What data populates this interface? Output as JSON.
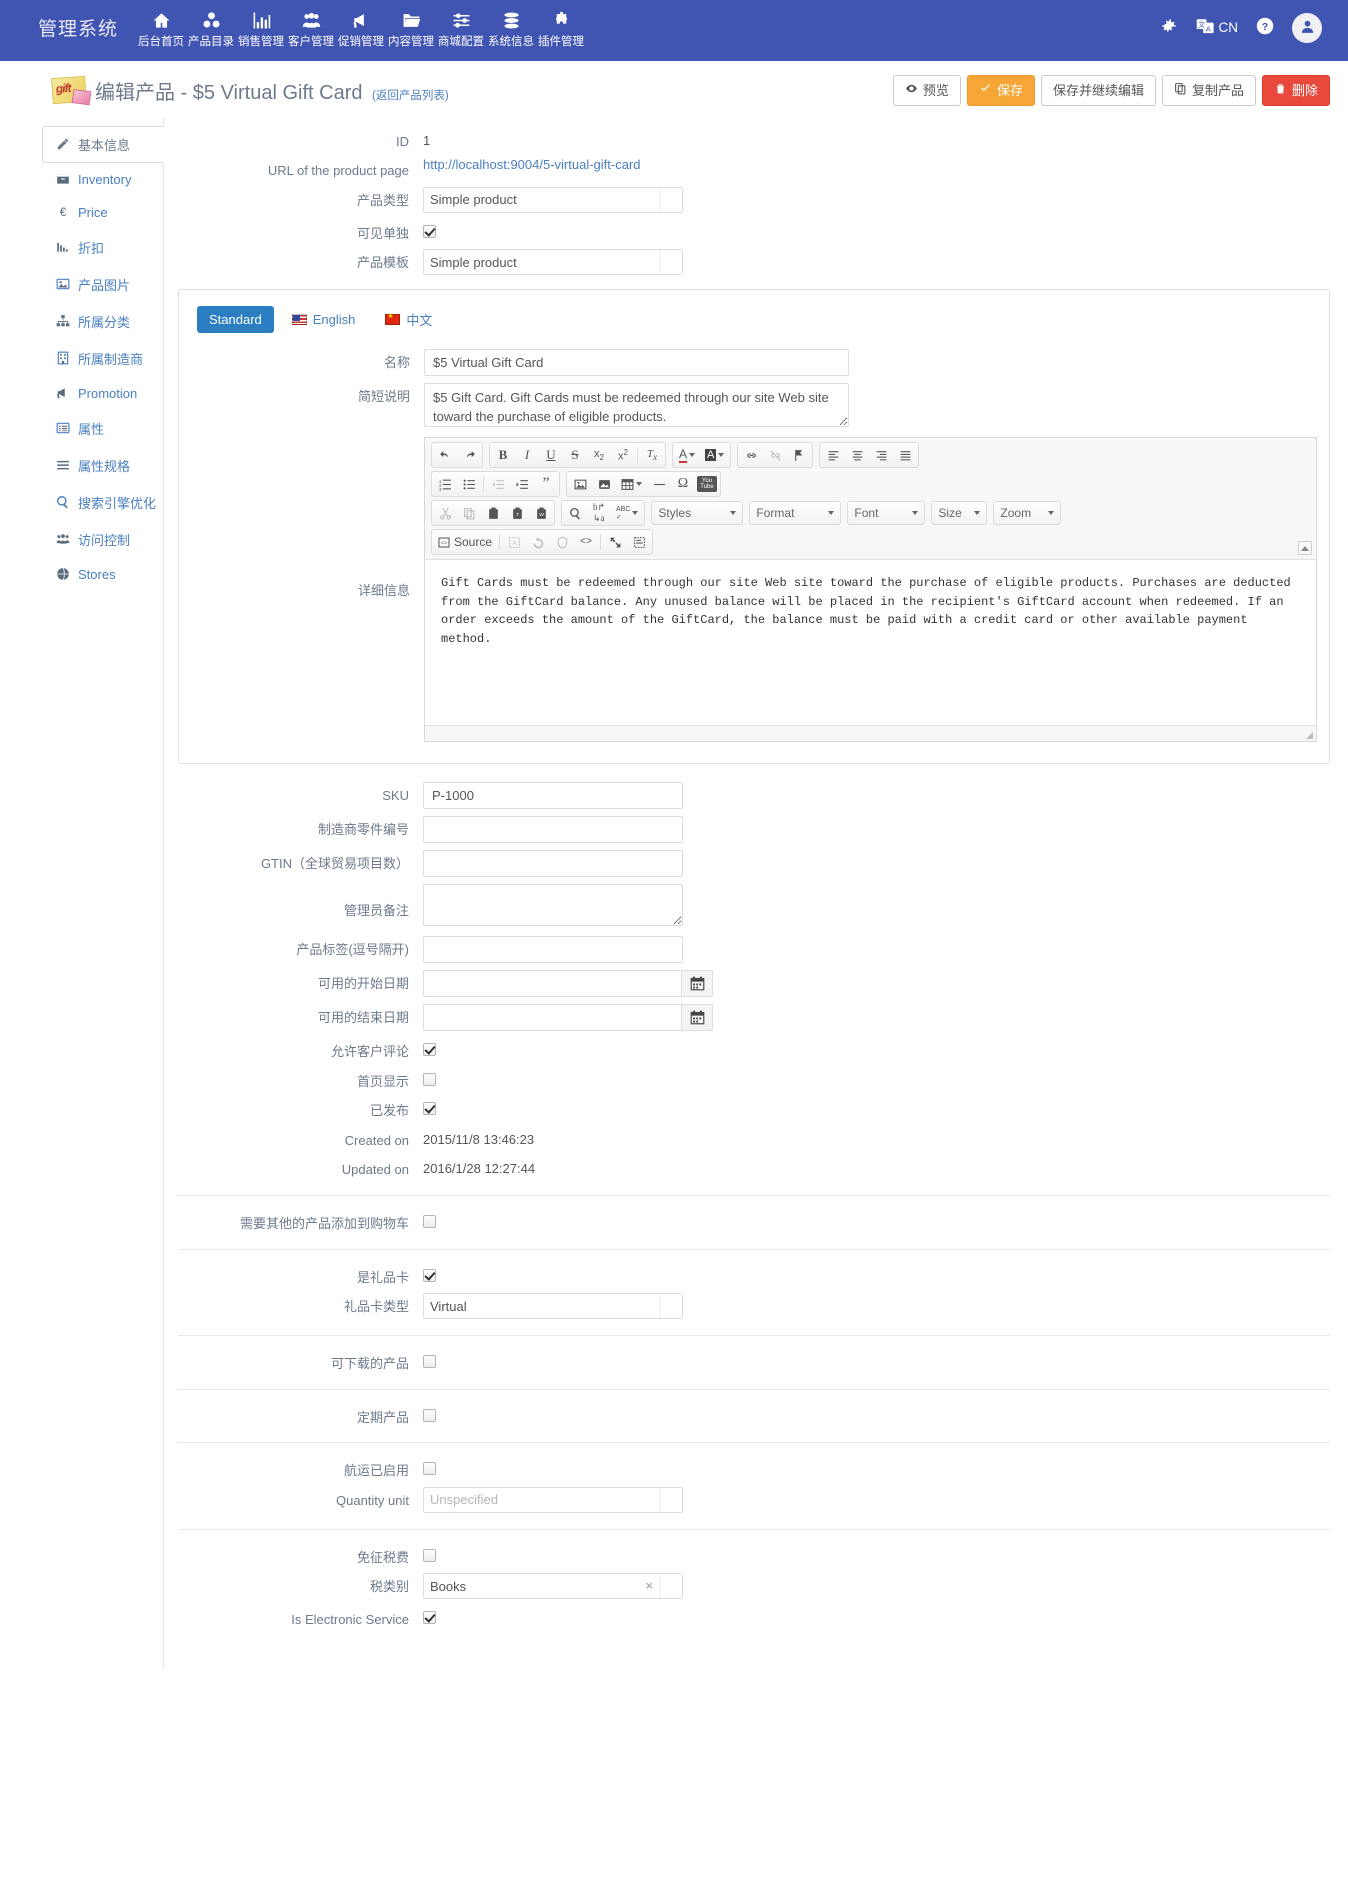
{
  "topnav": {
    "brand": "管理系统",
    "items": [
      {
        "label": "后台首页",
        "icon": "home-icon"
      },
      {
        "label": "产品目录",
        "icon": "catalog-icon"
      },
      {
        "label": "销售管理",
        "icon": "chart-bar-icon"
      },
      {
        "label": "客户管理",
        "icon": "users-icon"
      },
      {
        "label": "促销管理",
        "icon": "megaphone-icon"
      },
      {
        "label": "内容管理",
        "icon": "folder-icon"
      },
      {
        "label": "商城配置",
        "icon": "sliders-icon"
      },
      {
        "label": "系统信息",
        "icon": "database-icon"
      },
      {
        "label": "插件管理",
        "icon": "puzzle-icon"
      }
    ],
    "right": {
      "gear": "gear-icon",
      "language_icon": "translate-icon",
      "language_label": "CN",
      "help": "question-circle-icon",
      "avatar": "user-avatar-icon"
    }
  },
  "header": {
    "icon": "gift-card-icon",
    "title": "编辑产品 - $5 Virtual Gift Card",
    "back_link": "(返回产品列表)",
    "buttons": [
      {
        "label": "预览",
        "icon": "eye-icon",
        "style": "default"
      },
      {
        "label": "保存",
        "icon": "check-icon",
        "style": "orange"
      },
      {
        "label": "保存并继续编辑",
        "icon": "",
        "style": "default"
      },
      {
        "label": "复制产品",
        "icon": "copy-icon",
        "style": "default"
      },
      {
        "label": "删除",
        "icon": "trash-icon",
        "style": "red"
      }
    ]
  },
  "sidebar": {
    "items": [
      {
        "label": "基本信息",
        "icon": "pencil-icon",
        "active": true
      },
      {
        "label": "Inventory",
        "icon": "box-icon",
        "active": false
      },
      {
        "label": "Price",
        "icon": "euro-icon",
        "active": false
      },
      {
        "label": "折扣",
        "icon": "bar-chart-icon",
        "active": false
      },
      {
        "label": "产品图片",
        "icon": "image-icon",
        "active": false
      },
      {
        "label": "所属分类",
        "icon": "sitemap-icon",
        "active": false
      },
      {
        "label": "所属制造商",
        "icon": "building-icon",
        "active": false
      },
      {
        "label": "Promotion",
        "icon": "megaphone-icon",
        "active": false
      },
      {
        "label": "属性",
        "icon": "list-alt-icon",
        "active": false
      },
      {
        "label": "属性规格",
        "icon": "bars-icon",
        "active": false
      },
      {
        "label": "搜索引擎优化",
        "icon": "search-icon",
        "active": false
      },
      {
        "label": "访问控制",
        "icon": "group-icon",
        "active": false
      },
      {
        "label": "Stores",
        "icon": "globe-icon",
        "active": false
      }
    ]
  },
  "form": {
    "id_label": "ID",
    "id_value": "1",
    "url_label": "URL of the product page",
    "url_value": "http://localhost:9004/5-virtual-gift-card",
    "product_type_label": "产品类型",
    "product_type_value": "Simple product",
    "visible_individually_label": "可见单独",
    "visible_individually_checked": true,
    "product_template_label": "产品模板",
    "product_template_value": "Simple product",
    "locale_tabs": [
      {
        "label": "Standard",
        "flag": "none",
        "active": true
      },
      {
        "label": "English",
        "flag": "us",
        "active": false
      },
      {
        "label": "中文",
        "flag": "cn",
        "active": false
      }
    ],
    "name_label": "名称",
    "name_value": "$5 Virtual Gift Card",
    "short_desc_label": "简短说明",
    "short_desc_value": "$5 Gift Card. Gift Cards must be redeemed through our site Web site toward the purchase of eligible products.",
    "full_desc_label": "详细信息",
    "full_desc_value": "Gift Cards must be redeemed through our site Web site toward the purchase of eligible products. Purchases are deducted from the GiftCard balance. Any unused balance will be placed in the recipient's GiftCard account when redeemed. If an order exceeds the amount of the GiftCard, the balance must be paid with a credit card or other available payment method.",
    "sku_label": "SKU",
    "sku_value": "P-1000",
    "mpn_label": "制造商零件编号",
    "mpn_value": "",
    "gtin_label": "GTIN（全球贸易项目数）",
    "gtin_value": "",
    "admin_comment_label": "管理员备注",
    "admin_comment_value": "",
    "tags_label": "产品标签(逗号隔开)",
    "tags_value": "",
    "available_start_label": "可用的开始日期",
    "available_start_value": "",
    "available_end_label": "可用的结束日期",
    "available_end_value": "",
    "allow_reviews_label": "允许客户评论",
    "allow_reviews_checked": true,
    "show_on_home_label": "首页显示",
    "show_on_home_checked": false,
    "published_label": "已发布",
    "published_checked": true,
    "created_on_label": "Created on",
    "created_on_value": "2015/11/8 13:46:23",
    "updated_on_label": "Updated on",
    "updated_on_value": "2016/1/28 12:27:44",
    "require_other_products_label": "需要其他的产品添加到购物车",
    "require_other_products_checked": false,
    "is_gift_card_label": "是礼品卡",
    "is_gift_card_checked": true,
    "gift_card_type_label": "礼品卡类型",
    "gift_card_type_value": "Virtual",
    "downloadable_label": "可下载的产品",
    "downloadable_checked": false,
    "recurring_label": "定期产品",
    "recurring_checked": false,
    "shipping_enabled_label": "航运已启用",
    "shipping_enabled_checked": false,
    "quantity_unit_label": "Quantity unit",
    "quantity_unit_placeholder": "Unspecified",
    "tax_exempt_label": "免征税费",
    "tax_exempt_checked": false,
    "tax_category_label": "税类别",
    "tax_category_value": "Books",
    "is_electronic_service_label": "Is Electronic Service",
    "is_electronic_service_checked": true
  },
  "editor": {
    "row1": [
      {
        "name": "undo-icon",
        "glyph": "↶"
      },
      {
        "name": "redo-icon",
        "glyph": "↷"
      },
      {
        "name": "bold-icon",
        "glyph": "B"
      },
      {
        "name": "italic-icon",
        "glyph": "I"
      },
      {
        "name": "underline-icon",
        "glyph": "U"
      },
      {
        "name": "strikethrough-icon",
        "glyph": "S"
      },
      {
        "name": "subscript-icon",
        "glyph": "x₂"
      },
      {
        "name": "superscript-icon",
        "glyph": "x²"
      },
      {
        "name": "remove-format-icon",
        "glyph": "Tx"
      },
      {
        "name": "text-color-icon",
        "glyph": "A"
      },
      {
        "name": "bg-color-icon",
        "glyph": "A"
      },
      {
        "name": "link-icon",
        "glyph": "🔗"
      },
      {
        "name": "unlink-icon",
        "glyph": "🔗"
      },
      {
        "name": "anchor-icon",
        "glyph": "⚑"
      },
      {
        "name": "align-left-icon",
        "glyph": "≡"
      },
      {
        "name": "align-center-icon",
        "glyph": "≡"
      },
      {
        "name": "align-right-icon",
        "glyph": "≡"
      },
      {
        "name": "align-justify-icon",
        "glyph": "≡"
      }
    ],
    "row2": [
      {
        "name": "numbered-list-icon",
        "glyph": "1."
      },
      {
        "name": "bulleted-list-icon",
        "glyph": "•"
      },
      {
        "name": "outdent-icon",
        "glyph": "⇤"
      },
      {
        "name": "indent-icon",
        "glyph": "⇥"
      },
      {
        "name": "blockquote-icon",
        "glyph": "”"
      },
      {
        "name": "image-icon",
        "glyph": "🖼"
      },
      {
        "name": "media-icon",
        "glyph": "▣"
      },
      {
        "name": "table-icon",
        "glyph": "▦"
      },
      {
        "name": "horizontal-rule-icon",
        "glyph": "—"
      },
      {
        "name": "special-char-icon",
        "glyph": "Ω"
      },
      {
        "name": "youtube-icon",
        "glyph": "▶"
      }
    ],
    "row3": [
      {
        "name": "cut-icon",
        "glyph": "✂"
      },
      {
        "name": "copy-icon",
        "glyph": "⧉"
      },
      {
        "name": "paste-icon",
        "glyph": "📋"
      },
      {
        "name": "paste-text-icon",
        "glyph": "📋"
      },
      {
        "name": "paste-word-icon",
        "glyph": "📋"
      },
      {
        "name": "find-icon",
        "glyph": "🔍"
      },
      {
        "name": "replace-icon",
        "glyph": "ab"
      },
      {
        "name": "spellcheck-icon",
        "glyph": "ABC"
      }
    ],
    "combos": [
      {
        "name": "styles-dropdown",
        "label": "Styles"
      },
      {
        "name": "format-dropdown",
        "label": "Format"
      },
      {
        "name": "font-dropdown",
        "label": "Font"
      },
      {
        "name": "size-dropdown",
        "label": "Size"
      },
      {
        "name": "zoom-dropdown",
        "label": "Zoom"
      }
    ],
    "row4": [
      {
        "name": "source-button",
        "glyph": "Source"
      },
      {
        "name": "templates-icon",
        "glyph": "A"
      },
      {
        "name": "restore-icon",
        "glyph": "↺"
      },
      {
        "name": "protect-icon",
        "glyph": "※"
      },
      {
        "name": "code-snippet-icon",
        "glyph": "<>"
      },
      {
        "name": "maximize-icon",
        "glyph": "⤢"
      },
      {
        "name": "show-blocks-icon",
        "glyph": "▤"
      }
    ]
  }
}
